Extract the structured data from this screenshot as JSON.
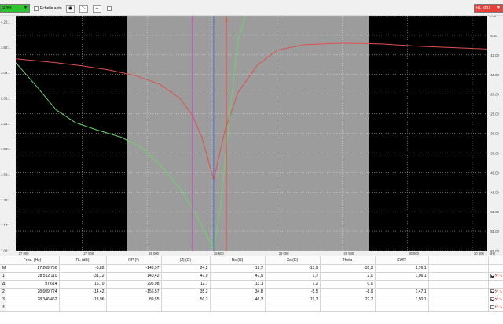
{
  "toolbar": {
    "left_select": "SWR",
    "autoscale_label": "Echelle auto",
    "right_select": "RL (dB)"
  },
  "chart_data": {
    "type": "line",
    "x_ticks": [
      "27 000",
      "27 500",
      "28 000",
      "28 500",
      "29 000",
      "29 500",
      "30 000",
      "30 500"
    ],
    "x_unit": "kHz",
    "xlim": [
      26990,
      30615
    ],
    "highlight_range": [
      27845,
      29705
    ],
    "left_ticks": [
      "4.25:1",
      "3.82:1",
      "3.09:1",
      "2.63:1",
      "2.24:1",
      "1.90:1",
      "1.62:1",
      "1.39:1",
      "1.17:1",
      "1.00:1"
    ],
    "right_ticks": [
      "0.00",
      "-5.00",
      "-10.00",
      "-15.00",
      "-20.00",
      "-25.00",
      "-30.00",
      "-35.00",
      "-40.00",
      "-45.00",
      "-50.00",
      "-55.00",
      "-60.00"
    ],
    "markers": [
      {
        "label": "2",
        "x": 28346,
        "color": "#e040e0"
      },
      {
        "label": "1",
        "x": 28512,
        "color": "#3b6fe0"
      },
      {
        "label": "3",
        "x": 28609,
        "color": "#e84030"
      }
    ],
    "series": [
      {
        "color": "#e05050",
        "points": [
          [
            26990,
            -11.0
          ],
          [
            27300,
            -12.0
          ],
          [
            27500,
            -12.8
          ],
          [
            27700,
            -13.8
          ],
          [
            27900,
            -15.2
          ],
          [
            28100,
            -17.5
          ],
          [
            28250,
            -21.0
          ],
          [
            28350,
            -25.5
          ],
          [
            28420,
            -31.0
          ],
          [
            28480,
            -38.0
          ],
          [
            28512,
            -42.0
          ],
          [
            28545,
            -37.0
          ],
          [
            28600,
            -29.0
          ],
          [
            28700,
            -19.5
          ],
          [
            28850,
            -12.5
          ],
          [
            29000,
            -8.8
          ],
          [
            29200,
            -7.4
          ],
          [
            29500,
            -7.0
          ],
          [
            29800,
            -7.2
          ],
          [
            30100,
            -7.8
          ],
          [
            30400,
            -8.2
          ],
          [
            30615,
            -8.5
          ]
        ]
      },
      {
        "color": "#6ad46a",
        "points": [
          [
            26990,
            -12.0
          ],
          [
            27150,
            -18.0
          ],
          [
            27300,
            -24.0
          ],
          [
            27450,
            -27.3
          ],
          [
            27600,
            -29.0
          ],
          [
            27800,
            -31.0
          ],
          [
            27950,
            -33.5
          ],
          [
            28100,
            -38.0
          ],
          [
            28250,
            -44.0
          ],
          [
            28380,
            -51.0
          ],
          [
            28450,
            -55.5
          ],
          [
            28512,
            -59.5
          ],
          [
            28560,
            -50.0
          ],
          [
            28620,
            -30.0
          ],
          [
            28700,
            -6.0
          ],
          [
            28760,
            0.0
          ]
        ]
      }
    ]
  },
  "table": {
    "headers": [
      "",
      "Freq. (Hz)",
      "RL (dB)",
      "RP (°)",
      "|Z| (Ω)",
      "Rs (Ω)",
      "Xs (Ω)",
      "Theta",
      "SWR",
      "",
      ""
    ],
    "rows": [
      {
        "label": "M",
        "cells": [
          "27 269 750",
          "-5,82",
          "-143,97",
          "24,2",
          "19,7",
          "-13,9",
          "-35,2",
          "2,76:1",
          "",
          ""
        ],
        "checked": false,
        "icons": false
      },
      {
        "label": "1",
        "cells": [
          "28 512 110",
          "-31,12",
          "140,42",
          "47,9",
          "47,9",
          "1,7",
          "2,0",
          "1,06:1",
          "",
          ""
        ],
        "checked": true,
        "icons": true
      },
      {
        "label": "Δ",
        "cells": [
          "97 614",
          "16,70",
          "296,98",
          "12,7",
          "13,1",
          "7,2",
          "0,0",
          "",
          "",
          ""
        ],
        "checked": false,
        "icons": false
      },
      {
        "label": "2",
        "cells": [
          "28 609 724",
          "-14,42",
          "-156,57",
          "35,2",
          "34,8",
          "-5,5",
          "-8,9",
          "1,47:1",
          "",
          ""
        ],
        "checked": true,
        "icons": true
      },
      {
        "label": "3",
        "cells": [
          "28 346 462",
          "-13,96",
          "89,55",
          "50,2",
          "46,3",
          "19,3",
          "22,7",
          "1,50:1",
          "",
          ""
        ],
        "checked": true,
        "icons": true
      },
      {
        "label": "4",
        "cells": [
          "",
          "",
          "",
          "",
          "",
          "",
          "",
          "",
          "",
          ""
        ],
        "checked": false,
        "icons": true
      }
    ]
  },
  "colors": {
    "swr_select": "#2fc52f",
    "rl_select": "#e8403a",
    "plot_bg": "#000000",
    "highlight_bg": "#9c9c9c"
  }
}
